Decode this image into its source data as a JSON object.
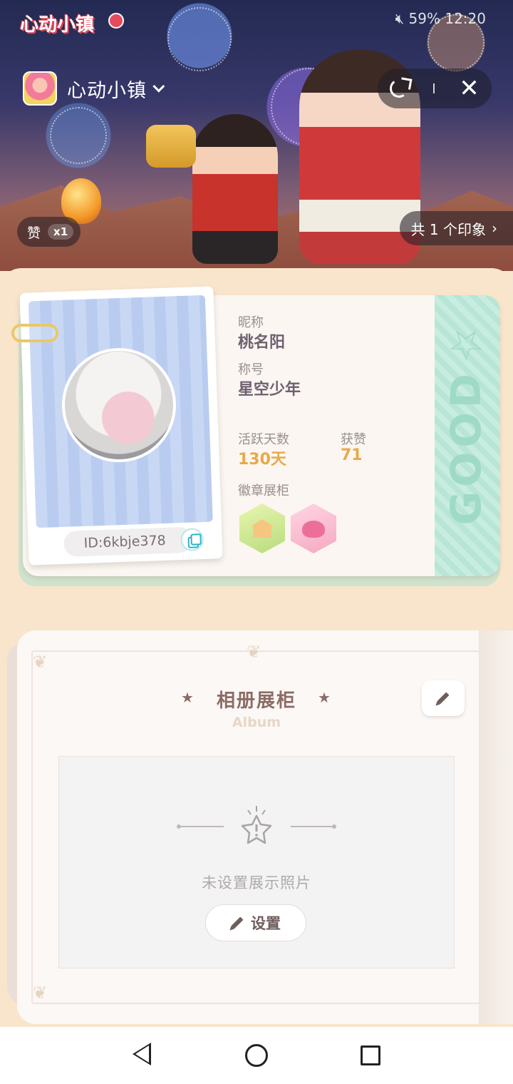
{
  "status_bar": {
    "battery": "59%",
    "time": "12:20"
  },
  "game_logo": "心动小镇",
  "header": {
    "app_name": "心动小镇"
  },
  "hero": {
    "like_label": "赞",
    "like_count": "x1",
    "impression_label": "共 1 个印象"
  },
  "profile": {
    "id_text": "ID:6kbje378",
    "nickname_label": "昵称",
    "nickname": "桃名阳",
    "title_label": "称号",
    "title": "星空少年",
    "active_days_label": "活跃天数",
    "active_days": "130天",
    "likes_label": "获赞",
    "likes": "71",
    "badges_label": "徽章展柜",
    "stripe_text": "GOOD☆"
  },
  "album": {
    "title": "相册展柜",
    "subtitle": "Album",
    "empty_text": "未设置展示照片",
    "set_label": "设置"
  },
  "icons": {
    "share": "share-icon",
    "close": "close-icon",
    "copy": "copy-icon",
    "edit": "pencil-icon",
    "empty": "star-icon"
  }
}
